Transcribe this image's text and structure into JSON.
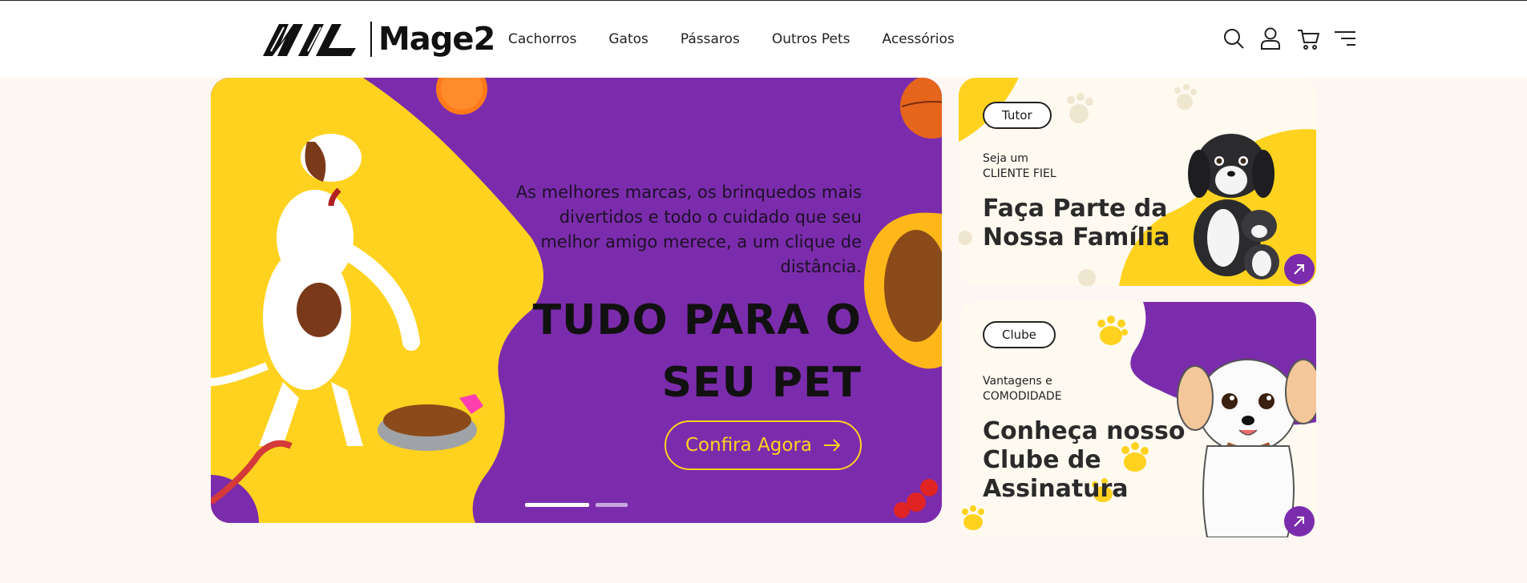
{
  "brand": {
    "name": "Mage2"
  },
  "nav": {
    "items": [
      "Cachorros",
      "Gatos",
      "Pássaros",
      "Outros Pets",
      "Acessórios"
    ]
  },
  "header_icons": [
    "search-icon",
    "user-icon",
    "cart-icon",
    "menu-icon"
  ],
  "hero": {
    "subtitle": "As melhores marcas, os brinquedos mais divertidos e todo o cuidado que seu melhor amigo merece, a um clique de distância.",
    "title_line1": "TUDO PARA O",
    "title_line2": "SEU PET",
    "cta_label": "Confira Agora",
    "slides": {
      "count": 2,
      "active": 1
    }
  },
  "cards": [
    {
      "tag": "Tutor",
      "small_line1": "Seja um",
      "small_line2": "CLIENTE FIEL",
      "title_line1": "Faça Parte da",
      "title_line2": "Nossa Família"
    },
    {
      "tag": "Clube",
      "small_line1": "Vantagens e",
      "small_line2": "COMODIDADE",
      "title_line1": "Conheça nosso",
      "title_line2": "Clube de",
      "title_line3": "Assinatura"
    }
  ],
  "colors": {
    "purple": "#7b2cac",
    "yellow": "#ffd21f",
    "background": "#fdf7f3"
  }
}
